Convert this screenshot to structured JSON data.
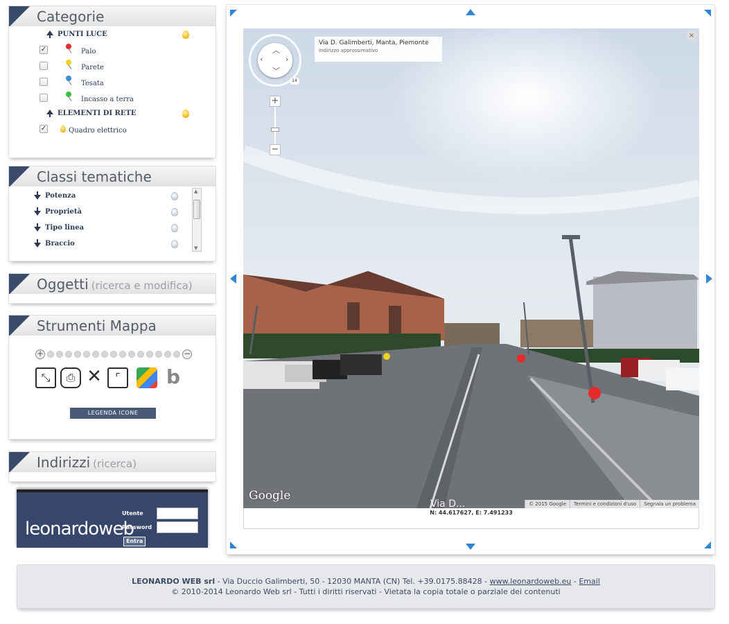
{
  "categorie": {
    "title": "Categorie",
    "sections": [
      {
        "label": "PUNTI LUCE",
        "items": [
          {
            "label": "Palo",
            "checked": true,
            "pin": "#e52b2b"
          },
          {
            "label": "Parete",
            "checked": false,
            "pin": "#f1d21f"
          },
          {
            "label": "Tesata",
            "checked": false,
            "pin": "#3a8fd8"
          },
          {
            "label": "Incasso a terra",
            "checked": false,
            "pin": "#34c13c"
          }
        ]
      },
      {
        "label": "ELEMENTI DI RETE",
        "items": [
          {
            "label": "Quadro elettrico",
            "checked": true
          }
        ]
      }
    ]
  },
  "classi": {
    "title": "Classi tematiche",
    "items": [
      "Potenza",
      "Proprietà",
      "Tipo linea",
      "Braccio"
    ]
  },
  "oggetti": {
    "title": "Oggetti",
    "sub": "(ricerca e modifica)"
  },
  "strumenti": {
    "title": "Strumenti Mappa",
    "legenda": "LEGENDA ICONE",
    "tools": [
      "fullscreen-icon",
      "print-icon",
      "clear-icon",
      "measure-icon",
      "google-maps-icon",
      "bing-icon"
    ]
  },
  "indirizzi": {
    "title": "Indirizzi",
    "sub": "(ricerca)"
  },
  "login": {
    "logo": "leonardoweb",
    "utente_label": "Utente",
    "password_label": "Password",
    "entra_label": "Entra"
  },
  "streetview": {
    "address": "Via D. Galimberti, Manta, Piemonte",
    "approx": "Indirizzo approssimativo",
    "close": "×",
    "zoom_in": "+",
    "zoom_out": "−",
    "badge": "14",
    "google": "Google",
    "street_overlay": "Via D...",
    "footer": [
      "© 2015 Google",
      "Termini e condizioni d'uso",
      "Segnala un problema"
    ]
  },
  "coords": "N: 44.617627, E: 7.491233",
  "footer": {
    "company": "LEONARDO WEB srl",
    "address": " - Via Duccio Galimberti, 50 - 12030 MANTA (CN) Tel. +39.0175.88428 - ",
    "website": "www.leonardoweb.eu",
    "sep": " - ",
    "email": "Email",
    "copyright": "© 2010-2014 Leonardo Web srl - Tutti i diritti riservati - Vietata la copia totale o parziale dei contenuti"
  },
  "colors": {
    "brand": "#36476b",
    "accent": "#3a4a6b",
    "nav_arrow": "#2e86d4"
  }
}
